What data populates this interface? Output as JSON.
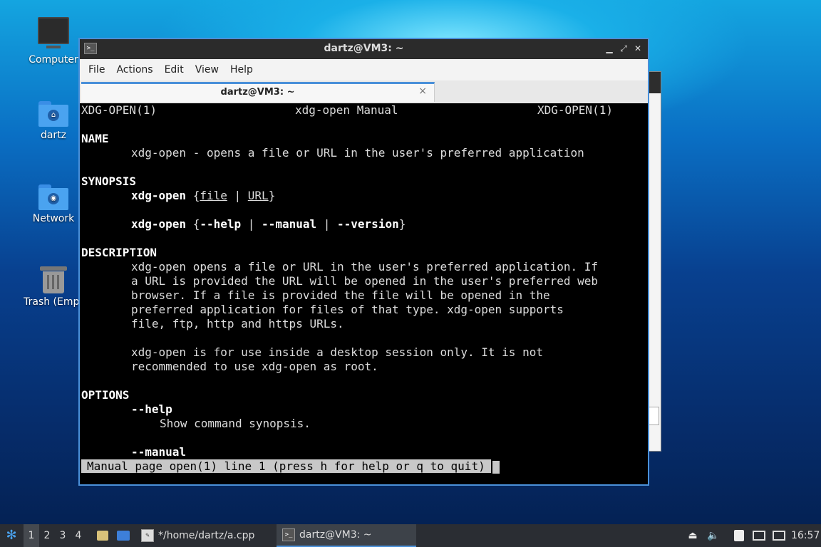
{
  "desktop": {
    "icons": [
      {
        "label": "Computer"
      },
      {
        "label": "dartz"
      },
      {
        "label": "Network"
      },
      {
        "label": "Trash (Empt"
      }
    ]
  },
  "terminal": {
    "title": "dartz@VM3: ~",
    "menu": [
      "File",
      "Actions",
      "Edit",
      "View",
      "Help"
    ],
    "tab_label": "dartz@VM3: ~",
    "tab_close": "×",
    "header": {
      "left": "XDG-OPEN(1)",
      "center": "xdg-open Manual",
      "right": "XDG-OPEN(1)"
    },
    "name_heading": "NAME",
    "name_text": "xdg-open - opens a file or URL in the user's preferred application",
    "synopsis_heading": "SYNOPSIS",
    "synopsis_cmd": "xdg-open",
    "synopsis_args1": {
      "open": "{",
      "file": "file",
      "sep": " | ",
      "url": "URL",
      "close": "}"
    },
    "synopsis_args2": {
      "open": "{",
      "help": "--help",
      "sep1": " | ",
      "manual": "--manual",
      "sep2": " | ",
      "version": "--version",
      "close": "}"
    },
    "description_heading": "DESCRIPTION",
    "description_lines": [
      "xdg-open opens a file or URL in the user's preferred application. If",
      "a URL is provided the URL will be opened in the user's preferred web",
      "browser. If a file is provided the file will be opened in the",
      "preferred application for files of that type. xdg-open supports",
      "file, ftp, http and https URLs."
    ],
    "description_lines2": [
      "xdg-open is for use inside a desktop session only. It is not",
      "recommended to use xdg-open as root."
    ],
    "options_heading": "OPTIONS",
    "opt_help": "--help",
    "opt_help_desc": "Show command synopsis.",
    "opt_manual": "--manual",
    "status_line": "Manual page open(1) line 1 (press h for help or q to quit)"
  },
  "taskbar": {
    "workspaces": [
      "1",
      "2",
      "3",
      "4"
    ],
    "active_workspace": "1",
    "tasks": [
      {
        "label": "*/home/dartz/a.cpp"
      },
      {
        "label": "dartz@VM3: ~"
      }
    ],
    "clock": "16:57"
  }
}
